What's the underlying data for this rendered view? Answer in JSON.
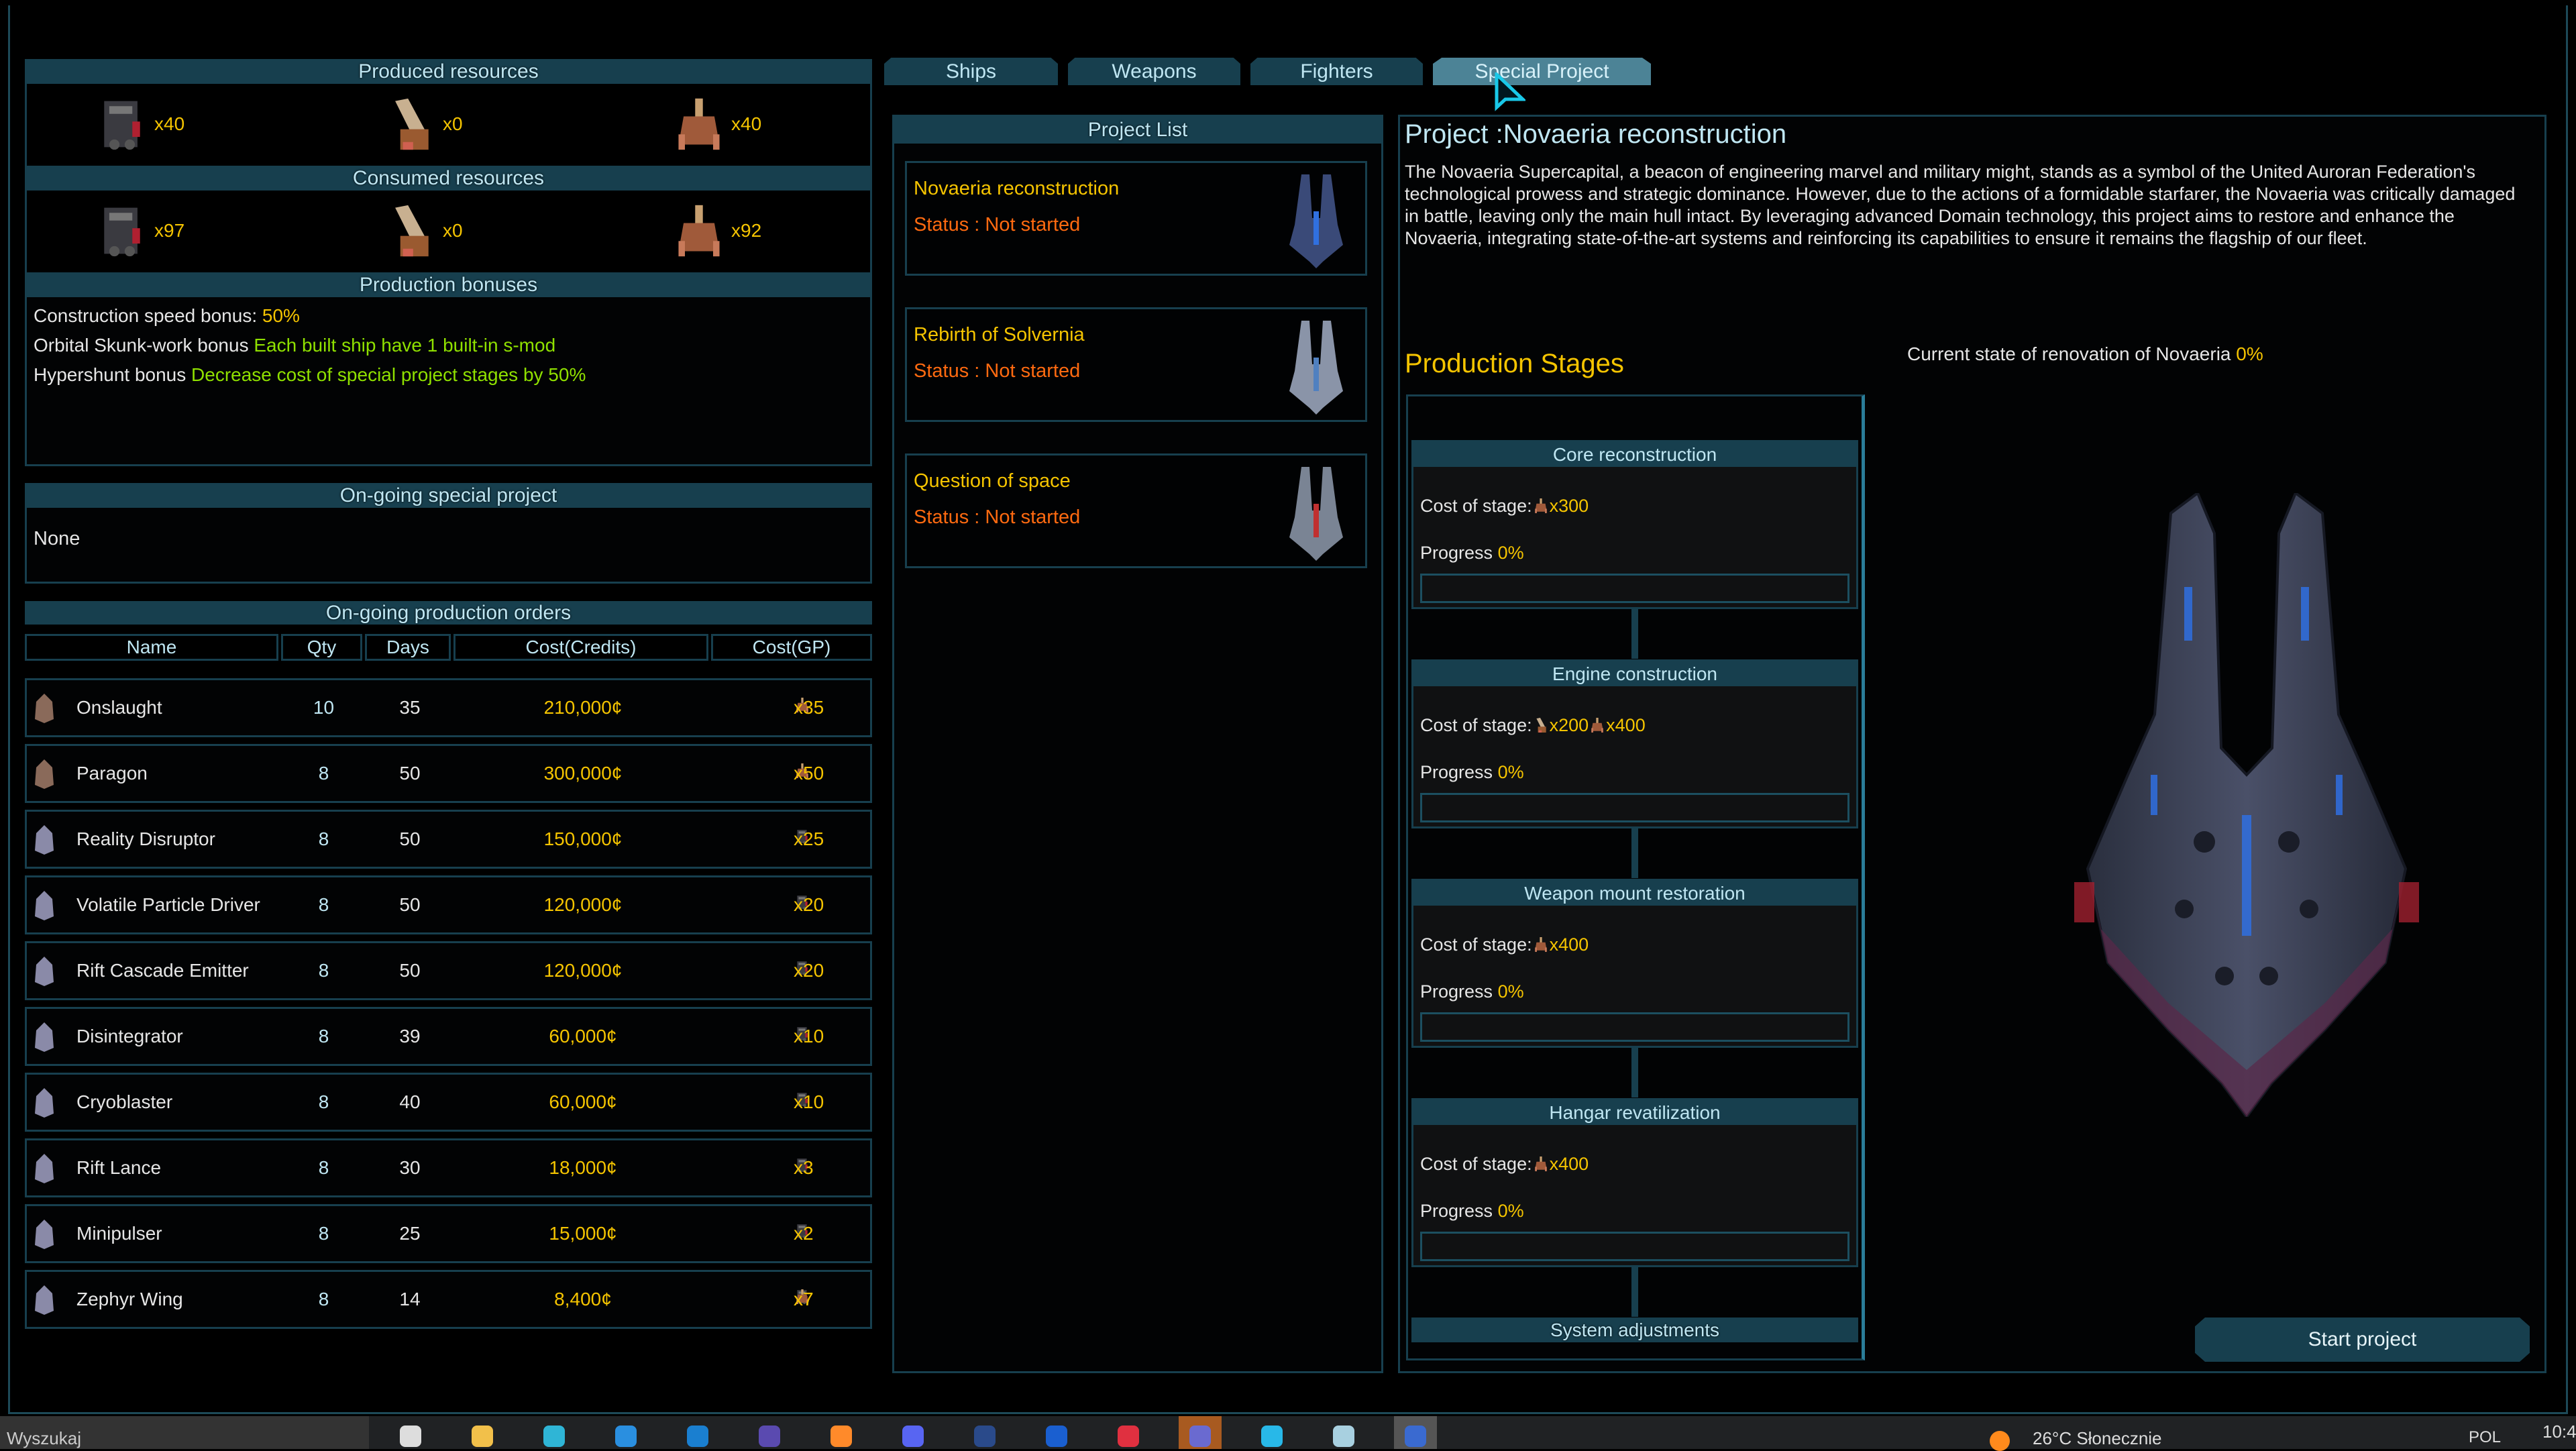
{
  "tabs": [
    {
      "label": "Ships"
    },
    {
      "label": "Weapons"
    },
    {
      "label": "Fighters"
    },
    {
      "label": "Special Project",
      "active": true
    }
  ],
  "produced": {
    "title": "Produced resources",
    "items": [
      {
        "icon": "machinery-resource-icon",
        "amount": "x40"
      },
      {
        "icon": "cannon-resource-icon",
        "amount": "x0"
      },
      {
        "icon": "hull-resource-icon",
        "amount": "x40"
      }
    ]
  },
  "consumed": {
    "title": "Consumed resources",
    "items": [
      {
        "icon": "machinery-resource-icon",
        "amount": "x97"
      },
      {
        "icon": "cannon-resource-icon",
        "amount": "x0"
      },
      {
        "icon": "hull-resource-icon",
        "amount": "x92"
      }
    ]
  },
  "bonuses": {
    "title": "Production bonuses",
    "items": [
      {
        "label": "Construction speed bonus:",
        "value": "50%",
        "color": "#f5c400"
      },
      {
        "label": "Orbital Skunk-work bonus",
        "value": "Each built ship have 1 built-in s-mod",
        "color": "#8fe000"
      },
      {
        "label": "Hypershunt bonus",
        "value": "Decrease cost of special project stages by 50%",
        "color": "#8fe000"
      }
    ]
  },
  "ongoing_special": {
    "title": "On-going special project",
    "value": "None"
  },
  "orders": {
    "title": "On-going production orders",
    "columns": [
      "Name",
      "Qty",
      "Days",
      "Cost(Credits)",
      "Cost(GP)"
    ],
    "rows": [
      {
        "name": "Onslaught",
        "qty": "10",
        "days": "35",
        "credits": "210,000¢",
        "gp": [
          {
            "icon": "hull",
            "amount": "x35"
          }
        ]
      },
      {
        "name": "Paragon",
        "qty": "8",
        "days": "50",
        "credits": "300,000¢",
        "gp": [
          {
            "icon": "hull",
            "amount": "x50"
          }
        ]
      },
      {
        "name": "Reality Disruptor",
        "qty": "8",
        "days": "50",
        "credits": "150,000¢",
        "gp": [
          {
            "icon": "machinery",
            "amount": "x25"
          }
        ]
      },
      {
        "name": "Volatile Particle Driver",
        "qty": "8",
        "days": "50",
        "credits": "120,000¢",
        "gp": [
          {
            "icon": "machinery",
            "amount": "x20"
          }
        ]
      },
      {
        "name": "Rift Cascade Emitter",
        "qty": "8",
        "days": "50",
        "credits": "120,000¢",
        "gp": [
          {
            "icon": "machinery",
            "amount": "x20"
          }
        ]
      },
      {
        "name": "Disintegrator",
        "qty": "8",
        "days": "39",
        "credits": "60,000¢",
        "gp": [
          {
            "icon": "machinery",
            "amount": "x10"
          }
        ]
      },
      {
        "name": "Cryoblaster",
        "qty": "8",
        "days": "40",
        "credits": "60,000¢",
        "gp": [
          {
            "icon": "machinery",
            "amount": "x10"
          }
        ]
      },
      {
        "name": "Rift Lance",
        "qty": "8",
        "days": "30",
        "credits": "18,000¢",
        "gp": [
          {
            "icon": "machinery",
            "amount": "x3"
          }
        ]
      },
      {
        "name": "Minipulser",
        "qty": "8",
        "days": "25",
        "credits": "15,000¢",
        "gp": [
          {
            "icon": "machinery",
            "amount": "x2"
          }
        ]
      },
      {
        "name": "Zephyr Wing",
        "qty": "8",
        "days": "14",
        "credits": "8,400¢",
        "gp": [
          {
            "icon": "machinery",
            "amount": "x7"
          },
          {
            "icon": "hull",
            "amount": "x7"
          }
        ]
      }
    ]
  },
  "project_list": {
    "title": "Project List",
    "items": [
      {
        "name": "Novaeria reconstruction",
        "status": "Status :  Not started"
      },
      {
        "name": "Rebirth of Solvernia",
        "status": "Status :  Not started"
      },
      {
        "name": "Question of space",
        "status": "Status :  Not started"
      }
    ]
  },
  "project": {
    "title": "Project :Novaeria reconstruction",
    "description": "The Novaeria Supercapital, a beacon of engineering marvel and military might, stands as a symbol of the United Auroran Federation's technological prowess and strategic dominance.  However, due to the actions of a formidable starfarer, the Novaeria was critically damaged in battle, leaving only the main hull intact. By leveraging advanced Domain technology, this project aims to restore and enhance the Novaeria, integrating state-of-the-art systems and reinforcing its capabilities to ensure it remains the flagship of our fleet.",
    "stages_title": "Production Stages",
    "renovation_label": "Current state of renovation of Novaeria",
    "renovation_value": "0%",
    "cost_label": "Cost of stage:",
    "progress_label": "Progress",
    "stages": [
      {
        "name": "Core reconstruction",
        "costs": [
          {
            "icon": "hull",
            "amount": "x300"
          }
        ],
        "progress": "0%"
      },
      {
        "name": "Engine construction",
        "costs": [
          {
            "icon": "cannon",
            "amount": "x200"
          },
          {
            "icon": "hull",
            "amount": "x400"
          }
        ],
        "progress": "0%"
      },
      {
        "name": "Weapon mount restoration",
        "costs": [
          {
            "icon": "hull",
            "amount": "x400"
          }
        ],
        "progress": "0%"
      },
      {
        "name": "Hangar revatilization",
        "costs": [
          {
            "icon": "hull",
            "amount": "x400"
          }
        ],
        "progress": "0%"
      },
      {
        "name": "System adjustments"
      }
    ],
    "start_button": "Start project"
  },
  "taskbar": {
    "search": "Wyszukaj",
    "weather": "26°C  Słonecznie",
    "lang": "POL",
    "time": "10:4"
  },
  "colors": {
    "panel_header": "#173f4e",
    "accent_yellow": "#f5c400",
    "accent_green": "#8fe000",
    "status_orange": "#ff6a10"
  }
}
